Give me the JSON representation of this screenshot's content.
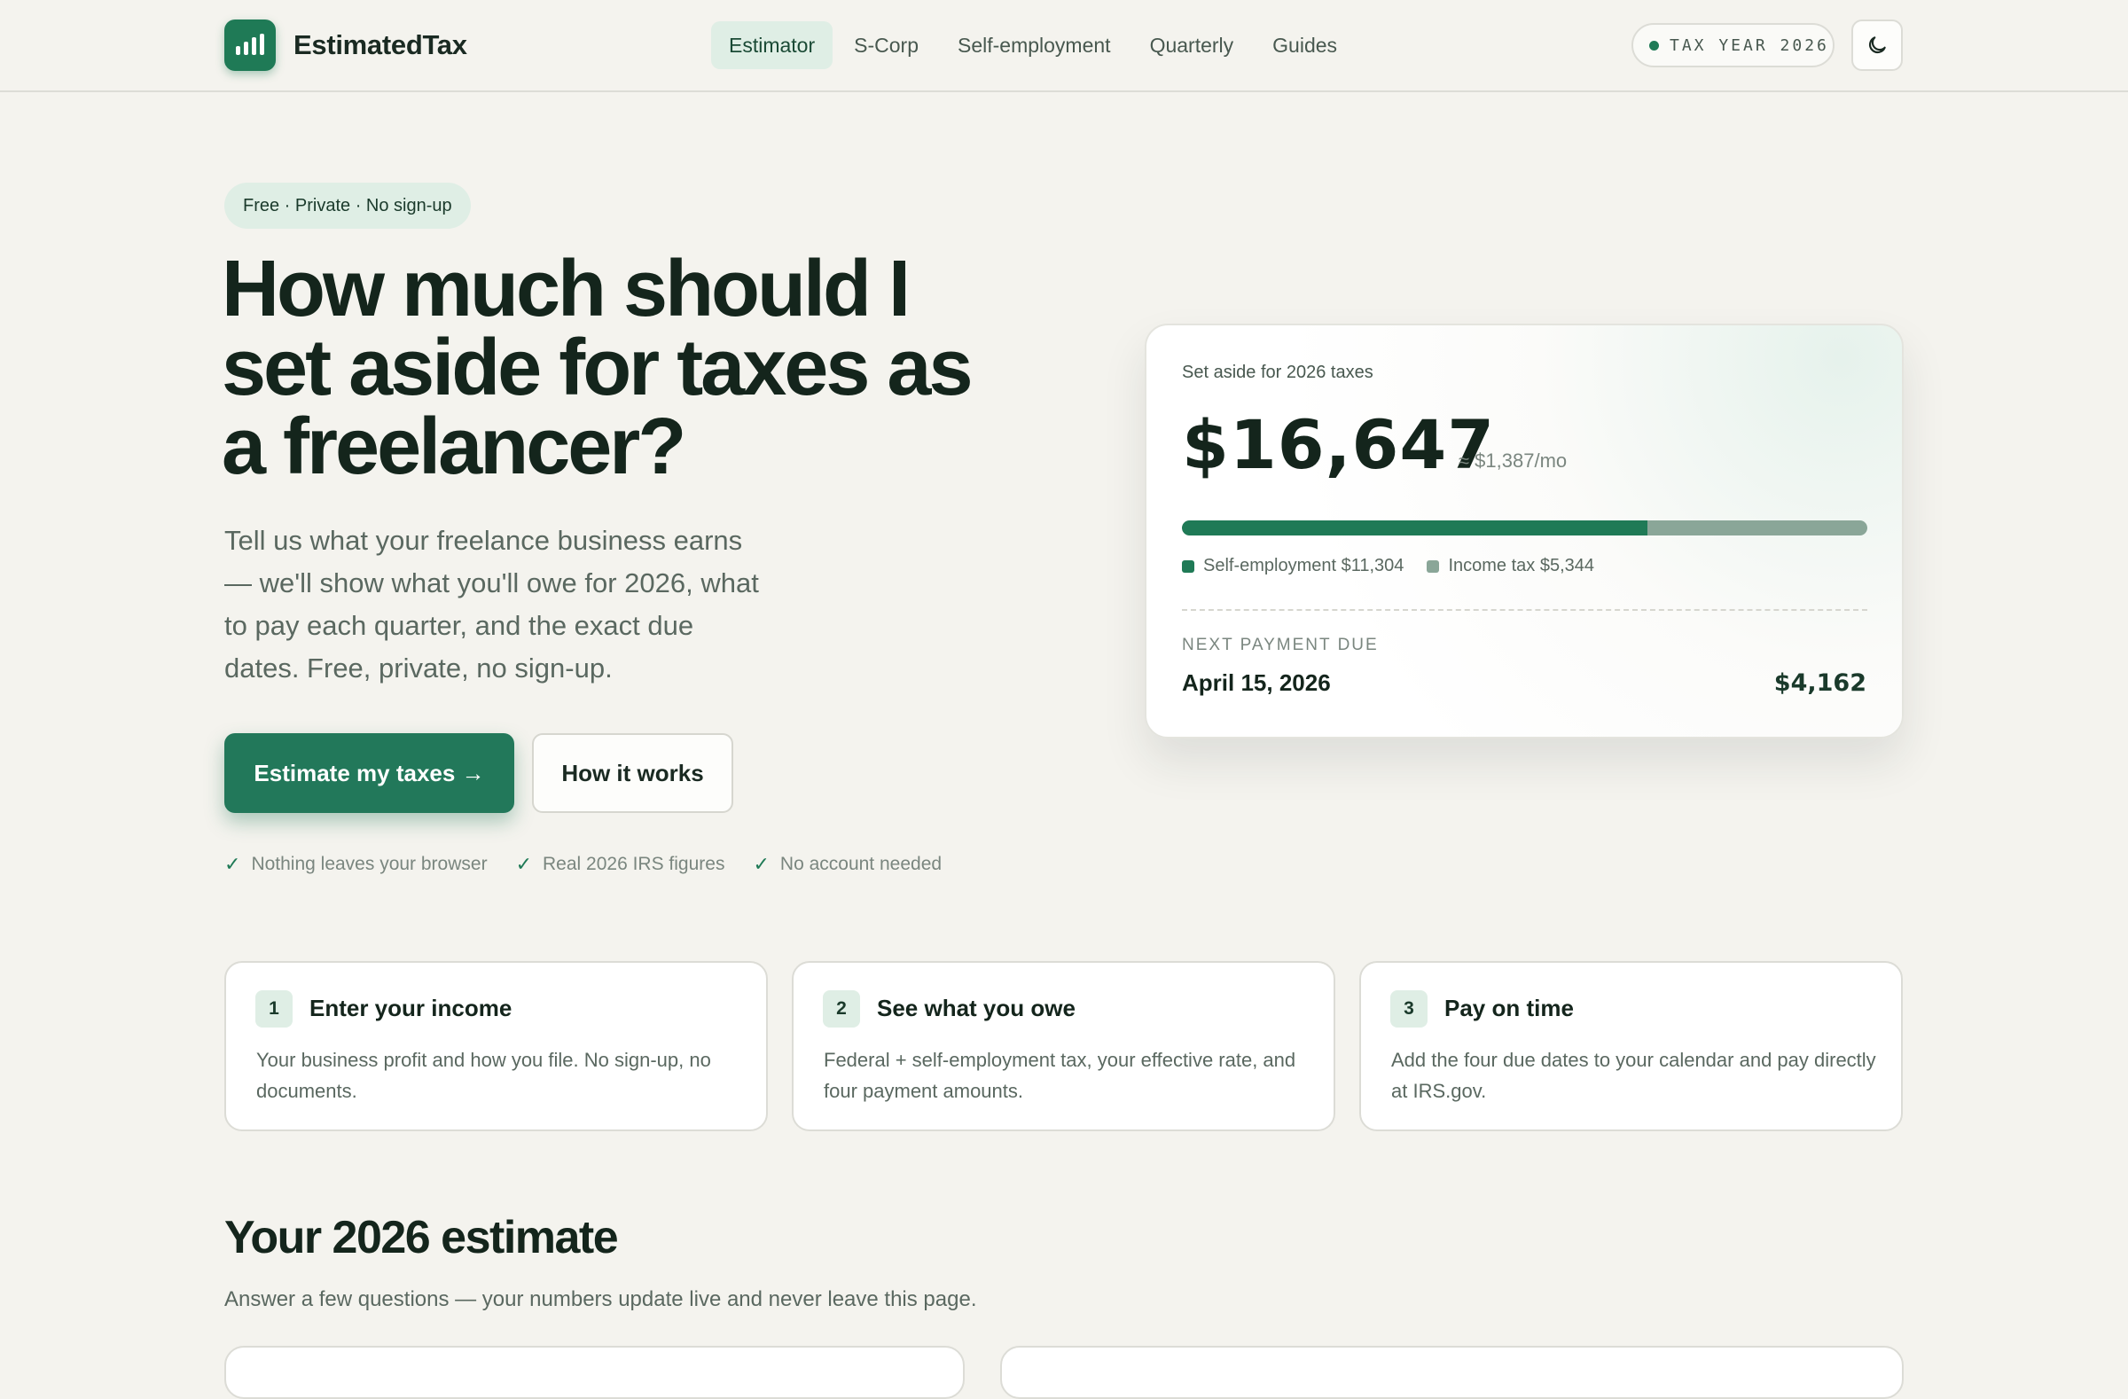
{
  "brand": {
    "name": "EstimatedTax"
  },
  "nav": {
    "items": [
      {
        "label": "Estimator",
        "active": true
      },
      {
        "label": "S-Corp",
        "active": false
      },
      {
        "label": "Self-employment",
        "active": false
      },
      {
        "label": "Quarterly",
        "active": false
      },
      {
        "label": "Guides",
        "active": false
      }
    ]
  },
  "header": {
    "tax_year_label": "TAX YEAR 2026",
    "theme_toggle_icon": "moon-icon"
  },
  "hero": {
    "tag": "Free · Private · No sign-up",
    "title": "How much should I set aside for taxes as a freelancer?",
    "subtitle": "Tell us what your freelance business earns — we'll show what you'll owe for 2026, what to pay each quarter, and the exact due dates. Free, private, no sign-up.",
    "primary_cta": "Estimate my taxes →",
    "secondary_cta": "How it works",
    "checks": [
      "Nothing leaves your browser",
      "Real 2026 IRS figures",
      "No account needed"
    ]
  },
  "estimate_card": {
    "label": "Set aside for 2026 taxes",
    "amount": "$16,647",
    "monthly": "≈ $1,387/mo",
    "breakdown": {
      "self_employment_fraction": 0.679,
      "self_employment_label": "Self-employment $11,304",
      "income_tax_label": "Income tax $5,344",
      "self_employment_color": "#1f7a56",
      "income_tax_color": "#8aa698"
    },
    "next_payment_label": "NEXT PAYMENT DUE",
    "next_payment_date": "April 15, 2026",
    "next_payment_amount": "$4,162"
  },
  "steps": [
    {
      "num": "1",
      "title": "Enter your income",
      "desc": "Your business profit and how you file. No sign-up, no documents."
    },
    {
      "num": "2",
      "title": "See what you owe",
      "desc": "Federal + self-employment tax, your effective rate, and four payment amounts."
    },
    {
      "num": "3",
      "title": "Pay on time",
      "desc": "Add the four due dates to your calendar and pay directly at IRS.gov."
    }
  ],
  "estimate_section": {
    "title": "Your 2026 estimate",
    "subtitle": "Answer a few questions — your numbers update live and never leave this page."
  }
}
